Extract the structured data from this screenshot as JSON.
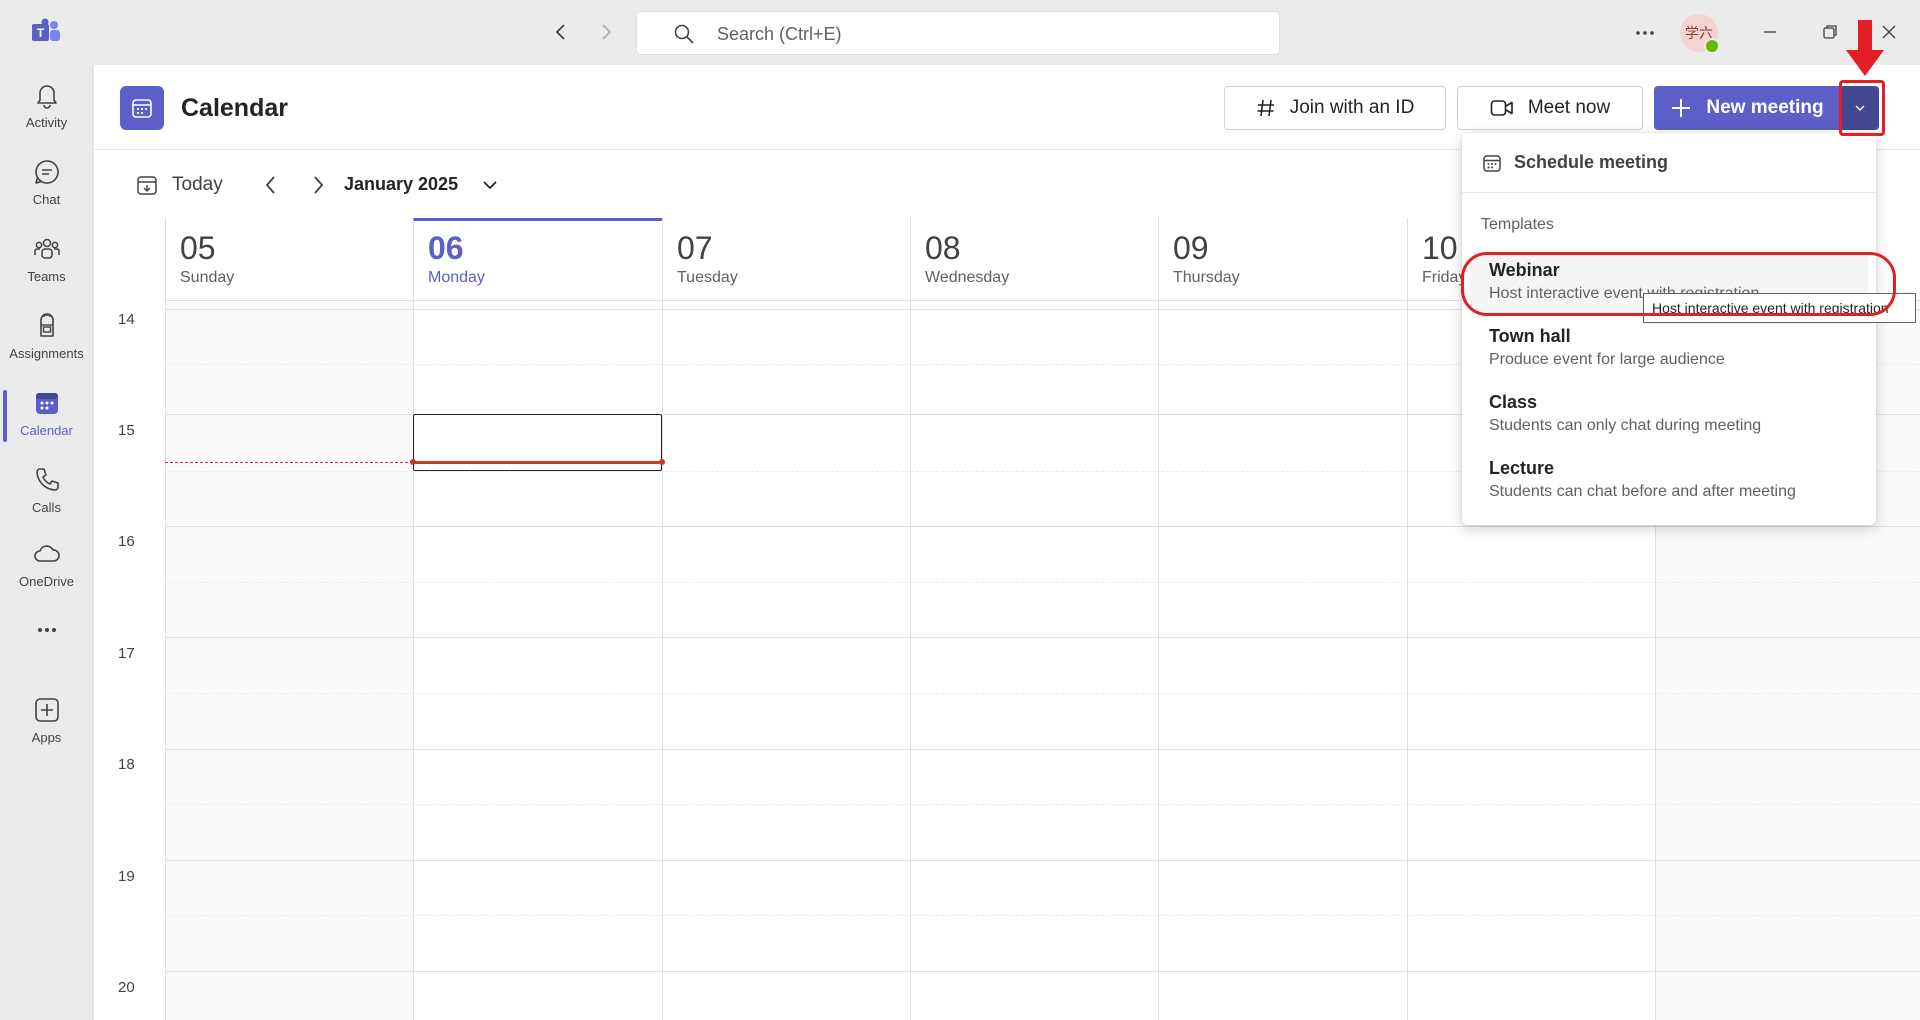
{
  "titlebar": {
    "search_placeholder": "Search (Ctrl+E)",
    "avatar_initials": "学六"
  },
  "rail": {
    "items": [
      {
        "label": "Activity",
        "icon": "bell-icon"
      },
      {
        "label": "Chat",
        "icon": "chat-icon"
      },
      {
        "label": "Teams",
        "icon": "teams-icon"
      },
      {
        "label": "Assignments",
        "icon": "backpack-icon"
      },
      {
        "label": "Calendar",
        "icon": "calendar-icon",
        "active": true
      },
      {
        "label": "Calls",
        "icon": "phone-icon"
      },
      {
        "label": "OneDrive",
        "icon": "cloud-icon"
      },
      {
        "label": "",
        "icon": "more-icon"
      },
      {
        "label": "Apps",
        "icon": "add-app-icon"
      }
    ]
  },
  "header": {
    "title": "Calendar",
    "join_label": "Join with an ID",
    "meet_now_label": "Meet now",
    "new_meeting_label": "New meeting"
  },
  "toolbar": {
    "today_label": "Today",
    "month_label": "January 2025"
  },
  "days": [
    {
      "num": "05",
      "name": "Sunday"
    },
    {
      "num": "06",
      "name": "Monday",
      "today": true
    },
    {
      "num": "07",
      "name": "Tuesday"
    },
    {
      "num": "08",
      "name": "Wednesday"
    },
    {
      "num": "09",
      "name": "Thursday"
    },
    {
      "num": "10",
      "name": "Friday"
    },
    {
      "num": "",
      "name": ""
    }
  ],
  "hours": [
    "14",
    "15",
    "16",
    "17",
    "18",
    "19",
    "20"
  ],
  "menu": {
    "schedule_label": "Schedule meeting",
    "section_label": "Templates",
    "items": [
      {
        "title": "Webinar",
        "desc": "Host interactive event with registration"
      },
      {
        "title": "Town hall",
        "desc": "Produce event for large audience"
      },
      {
        "title": "Class",
        "desc": "Students can only chat during meeting"
      },
      {
        "title": "Lecture",
        "desc": "Students can chat before and after meeting"
      }
    ],
    "tooltip": "Host interactive event with registration"
  },
  "colors": {
    "brand": "#5b5fc7",
    "brand_dark": "#444791",
    "annotation": "#e31e24",
    "now_line": "#c43e1c"
  }
}
